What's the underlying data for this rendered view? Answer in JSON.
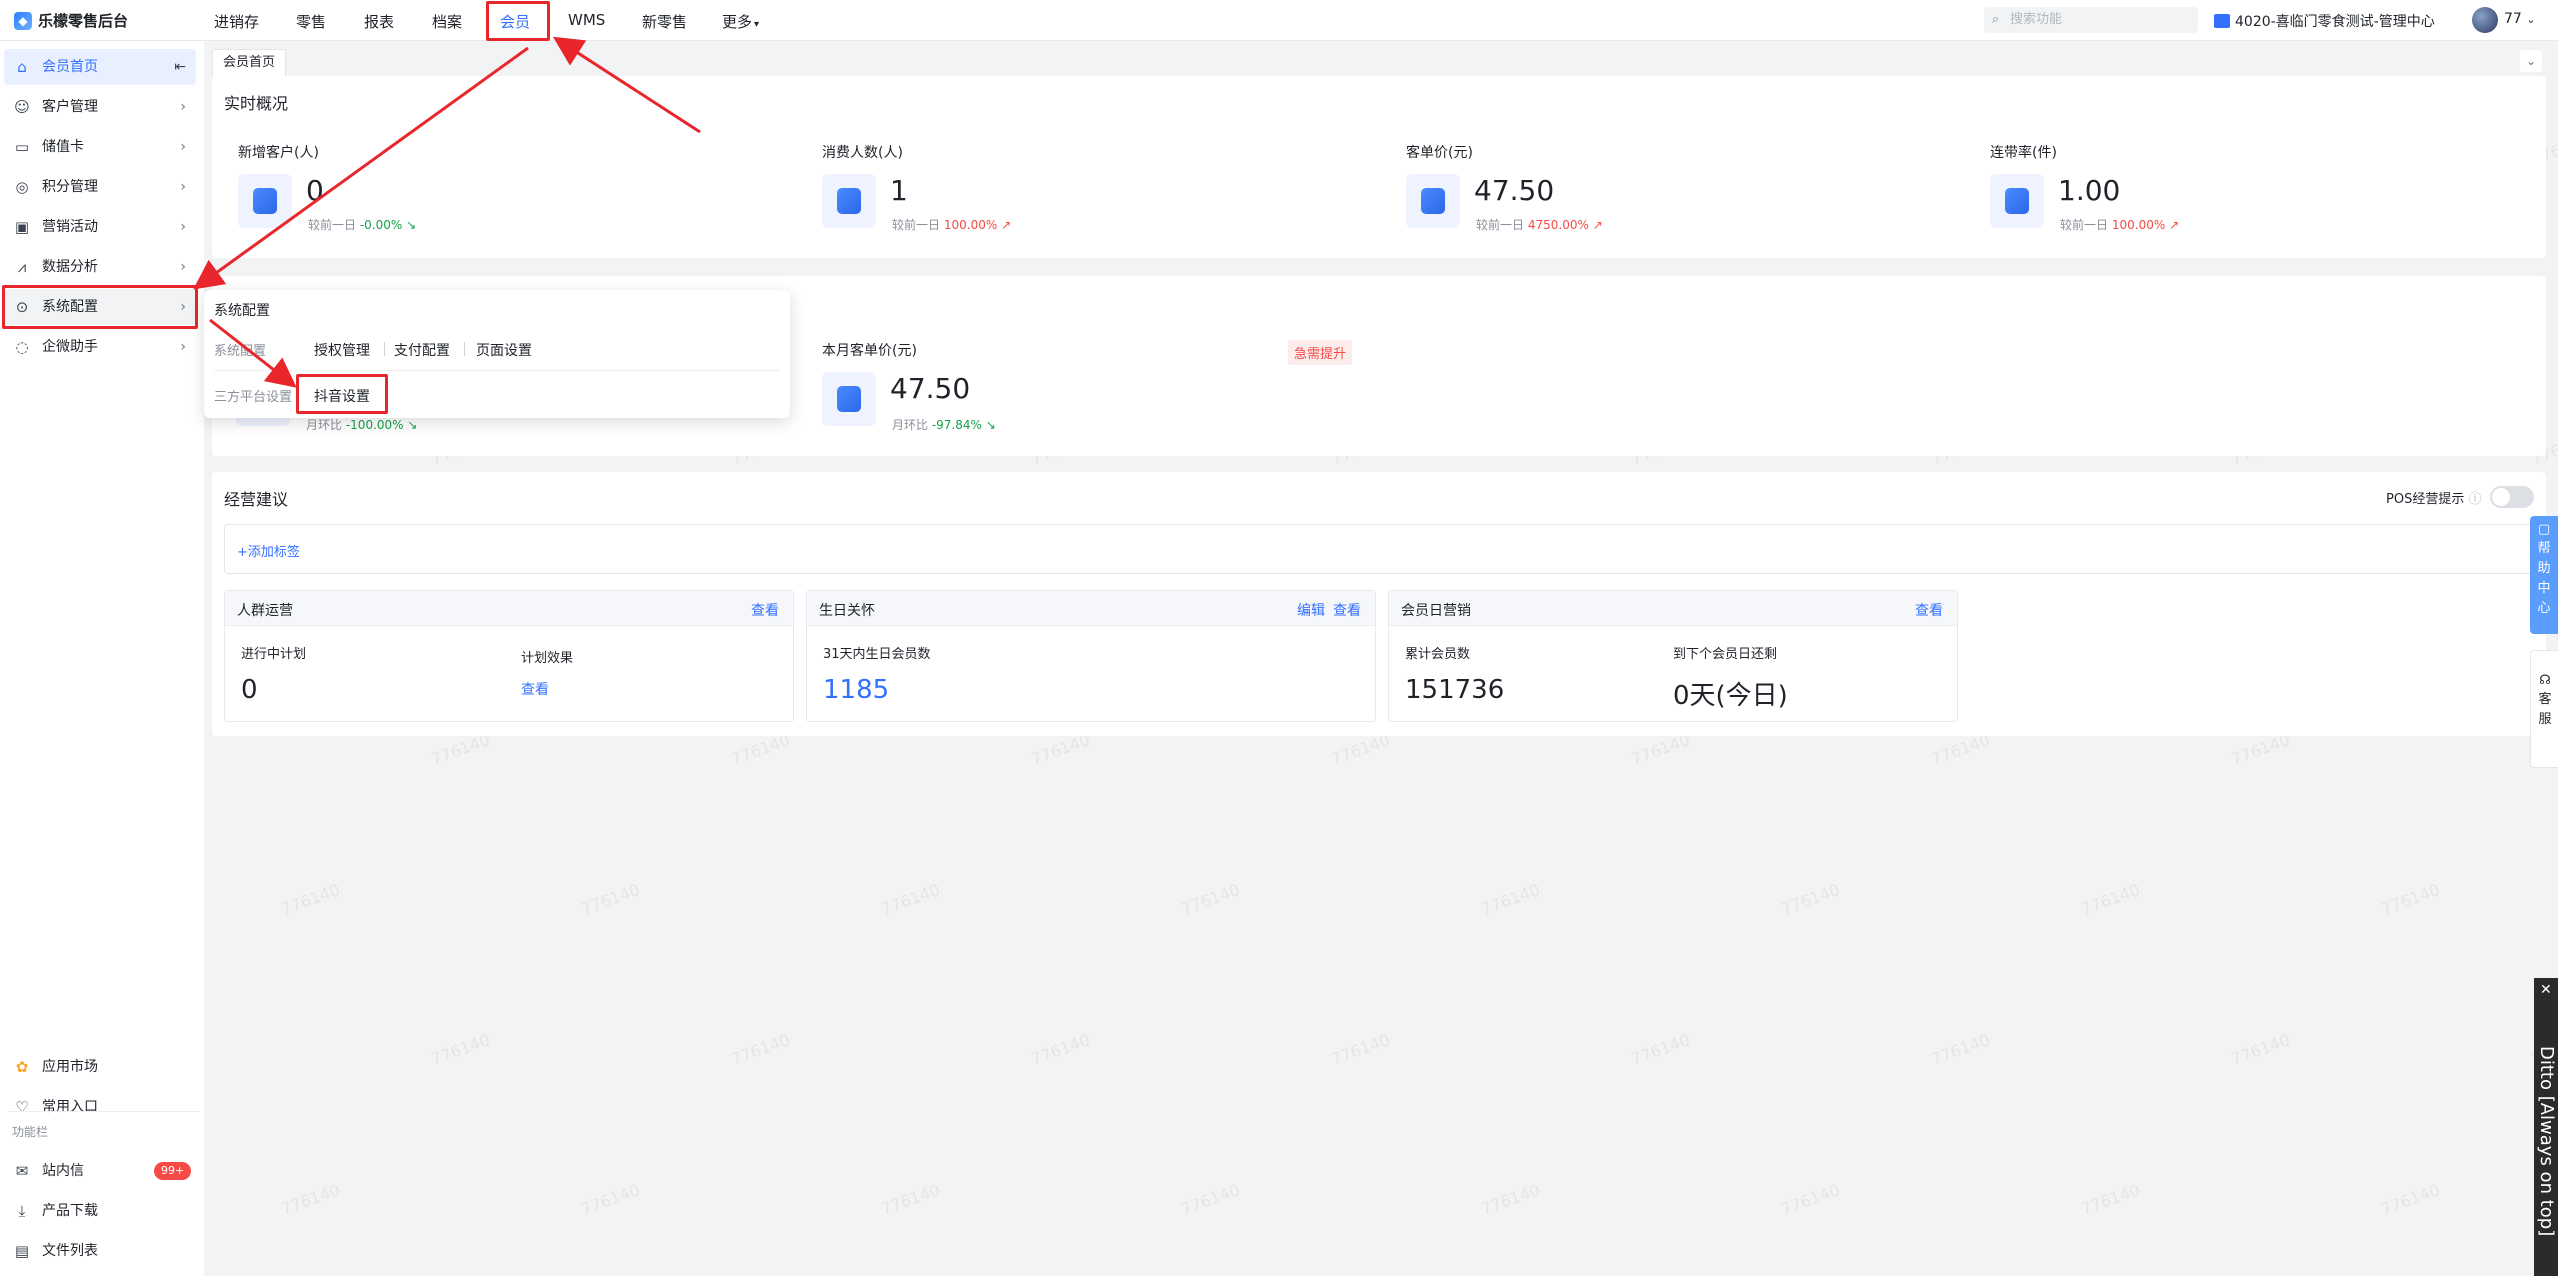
{
  "app": {
    "title": "乐檬零售后台"
  },
  "nav": [
    "进销存",
    "零售",
    "报表",
    "档案",
    "会员",
    "WMS",
    "新零售",
    "更多"
  ],
  "nav_active_index": 4,
  "search": {
    "placeholder": "搜索功能"
  },
  "store": "4020-喜临门零食测试-管理中心",
  "user": "77",
  "sidebar": {
    "items": [
      {
        "label": "会员首页",
        "icon": "home-icon"
      },
      {
        "label": "客户管理",
        "icon": "user-icon"
      },
      {
        "label": "储值卡",
        "icon": "card-icon"
      },
      {
        "label": "积分管理",
        "icon": "points-icon"
      },
      {
        "label": "营销活动",
        "icon": "ticket-icon"
      },
      {
        "label": "数据分析",
        "icon": "chart-icon"
      },
      {
        "label": "系统配置",
        "icon": "settings-icon"
      },
      {
        "label": "企微助手",
        "icon": "chat-icon"
      }
    ],
    "bottom": [
      {
        "label": "应用市场",
        "icon": "apps-icon"
      },
      {
        "label": "常用入口",
        "icon": "heart-icon"
      }
    ],
    "section_label": "功能栏",
    "func": [
      {
        "label": "站内信",
        "icon": "mail-icon",
        "badge": "99+"
      },
      {
        "label": "产品下载",
        "icon": "download-icon"
      },
      {
        "label": "文件列表",
        "icon": "file-icon"
      }
    ]
  },
  "tab": "会员首页",
  "realtime": {
    "title": "实时概况",
    "metrics": [
      {
        "label": "新增客户(人)",
        "value": "0",
        "cmp_label": "较前一日",
        "cmp": "-0.00%",
        "trend": "down"
      },
      {
        "label": "消费人数(人)",
        "value": "1",
        "cmp_label": "较前一日",
        "cmp": "100.00%",
        "trend": "up"
      },
      {
        "label": "客单价(元)",
        "value": "47.50",
        "cmp_label": "较前一日",
        "cmp": "4750.00%",
        "trend": "up"
      },
      {
        "label": "连带率(件)",
        "value": "1.00",
        "cmp_label": "较前一日",
        "cmp": "100.00%",
        "trend": "up"
      }
    ]
  },
  "monthly": {
    "metric2_label": "本月客单价(元)",
    "metric2_value": "47.50",
    "metric2_cmp_label": "月环比",
    "metric2_cmp": "-97.84%",
    "metric1_cmp_label": "月环比",
    "metric1_cmp": "-100.00%",
    "badge": "急需提升"
  },
  "popup": {
    "title": "系统配置",
    "row1_label": "系统配置",
    "row1_links": [
      "授权管理",
      "支付配置",
      "页面设置"
    ],
    "row2_label": "三方平台设置",
    "row2_links": [
      "抖音设置"
    ]
  },
  "advice": {
    "title": "经营建议",
    "pos_tip": "POS经营提示",
    "add_tag": "+添加标签",
    "cards": [
      {
        "title": "人群运营",
        "actions": [
          "查看"
        ],
        "f1_label": "进行中计划",
        "f1_value": "0",
        "f2_label": "计划效果",
        "f2_value": "查看"
      },
      {
        "title": "生日关怀",
        "actions": [
          "编辑",
          "查看"
        ],
        "f1_label": "31天内生日会员数",
        "f1_value": "1185"
      },
      {
        "title": "会员日营销",
        "actions": [
          "查看"
        ],
        "f1_label": "累计会员数",
        "f1_value": "151736",
        "f2_label": "到下个会员日还剩",
        "f2_value": "0天(今日)"
      }
    ]
  },
  "float": {
    "help": "帮助中心",
    "service": "客服"
  },
  "ditto": "Ditto [Always on top]",
  "watermark": "776140"
}
